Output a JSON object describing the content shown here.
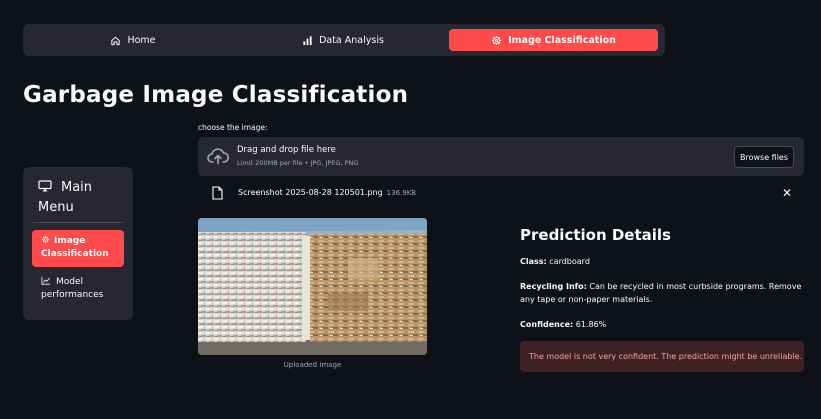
{
  "nav": {
    "items": [
      {
        "label": "Home",
        "icon": "home-icon"
      },
      {
        "label": "Data Analysis",
        "icon": "bar-chart-icon"
      },
      {
        "label": "Image Classification",
        "icon": "gear-icon",
        "active": true
      }
    ],
    "active_color": "#ff4b4b"
  },
  "page": {
    "title": "Garbage Image Classification"
  },
  "sidebar": {
    "title": "Main Menu",
    "title_icon": "monitor-icon",
    "items": [
      {
        "label": "Image Classification",
        "icon": "gear-icon",
        "active": true
      },
      {
        "label": "Model performances",
        "icon": "line-chart-icon",
        "active": false
      }
    ]
  },
  "uploader": {
    "label": "choose the image:",
    "drop_title": "Drag and drop file here",
    "drop_limit": "Limit 200MB per file • JPG, JPEG, PNG",
    "browse_label": "Browse files",
    "file_name": "Screenshot 2025-08-28 120501.png",
    "file_size": "136.9KB",
    "close_symbol": "✕"
  },
  "image": {
    "caption": "Uploaded Image"
  },
  "prediction": {
    "title": "Prediction Details",
    "class_label": "Class:",
    "class_value": "cardboard",
    "recycling_label": "Recycling Info:",
    "recycling_value": "Can be recycled in most curbside programs. Remove any tape or non-paper materials.",
    "confidence_label": "Confidence:",
    "confidence_value": "61.86%",
    "warning": "The model is not very confident. The prediction might be unreliable."
  },
  "colors": {
    "background": "#0e1117",
    "panel": "#262730",
    "accent": "#ff4b4b",
    "warning_bg": "#3d2125",
    "warning_text": "#f5a3a3"
  }
}
